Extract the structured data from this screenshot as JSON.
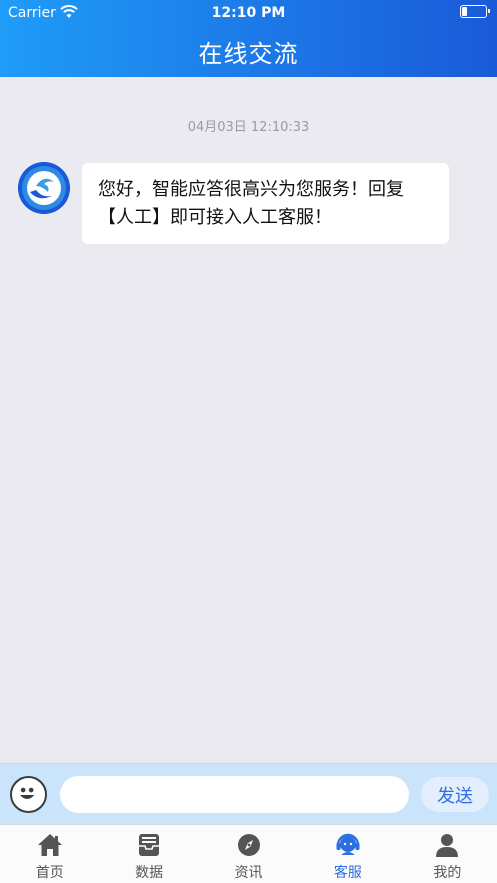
{
  "status_bar": {
    "carrier": "Carrier",
    "time": "12:10 PM"
  },
  "header": {
    "title": "在线交流"
  },
  "chat": {
    "timestamp": "04月03日 12:10:33",
    "messages": [
      {
        "text": "您好，智能应答很高兴为您服务！回复【人工】即可接入人工客服！"
      }
    ]
  },
  "input": {
    "value": "",
    "placeholder": "",
    "send_label": "发送"
  },
  "tabs": [
    {
      "label": "首页",
      "icon": "home-icon",
      "active": false
    },
    {
      "label": "数据",
      "icon": "inbox-icon",
      "active": false
    },
    {
      "label": "资讯",
      "icon": "compass-icon",
      "active": false
    },
    {
      "label": "客服",
      "icon": "support-agent-icon",
      "active": true
    },
    {
      "label": "我的",
      "icon": "user-icon",
      "active": false
    }
  ],
  "colors": {
    "header_start": "#1f9cf8",
    "header_end": "#1a5ad8",
    "accent": "#2b6fe0",
    "chat_bg": "#ebeaf1",
    "input_bar_bg": "#c9e4fb"
  }
}
